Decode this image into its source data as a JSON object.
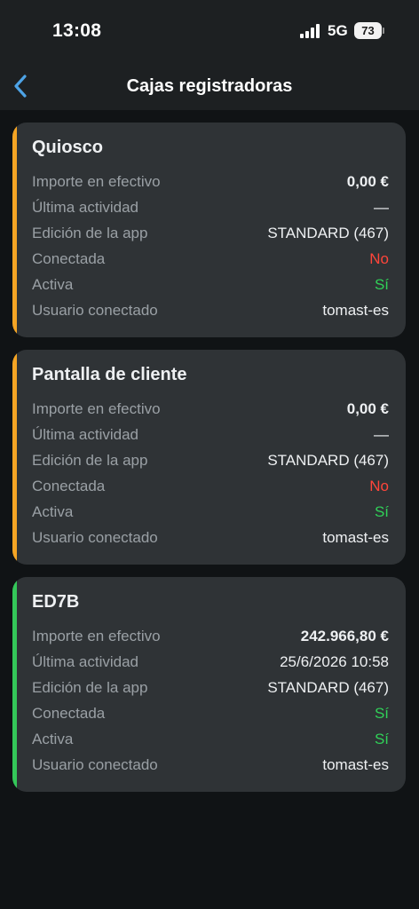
{
  "status_bar": {
    "time": "13:08",
    "network": "5G",
    "battery": "73"
  },
  "header": {
    "title": "Cajas registradoras",
    "back_icon": "chevron-left-icon"
  },
  "colors": {
    "accent_blue": "#4da3e6",
    "stripe_orange": "#f5a524",
    "stripe_green": "#34c759",
    "status_red": "#ff453a",
    "status_green": "#30d158"
  },
  "registers": [
    {
      "name": "Quiosco",
      "stripe": "orange",
      "rows": [
        {
          "label": "Importe en efectivo",
          "value": "0,00 €"
        },
        {
          "label": "Última actividad",
          "value": "—"
        },
        {
          "label": "Edición de la app",
          "value": "STANDARD (467)"
        },
        {
          "label": "Conectada",
          "value": "No"
        },
        {
          "label": "Activa",
          "value": "Sí"
        },
        {
          "label": "Usuario conectado",
          "value": "tomast-es"
        }
      ]
    },
    {
      "name": "Pantalla de cliente",
      "stripe": "orange",
      "rows": [
        {
          "label": "Importe en efectivo",
          "value": "0,00 €"
        },
        {
          "label": "Última actividad",
          "value": "—"
        },
        {
          "label": "Edición de la app",
          "value": "STANDARD (467)"
        },
        {
          "label": "Conectada",
          "value": "No"
        },
        {
          "label": "Activa",
          "value": "Sí"
        },
        {
          "label": "Usuario conectado",
          "value": "tomast-es"
        }
      ]
    },
    {
      "name": "ED7B",
      "stripe": "green",
      "rows": [
        {
          "label": "Importe en efectivo",
          "value": "242.966,80 €"
        },
        {
          "label": "Última actividad",
          "value": "25/6/2026 10:58"
        },
        {
          "label": "Edición de la app",
          "value": "STANDARD (467)"
        },
        {
          "label": "Conectada",
          "value": "Sí"
        },
        {
          "label": "Activa",
          "value": "Sí"
        },
        {
          "label": "Usuario conectado",
          "value": "tomast-es"
        }
      ]
    }
  ]
}
